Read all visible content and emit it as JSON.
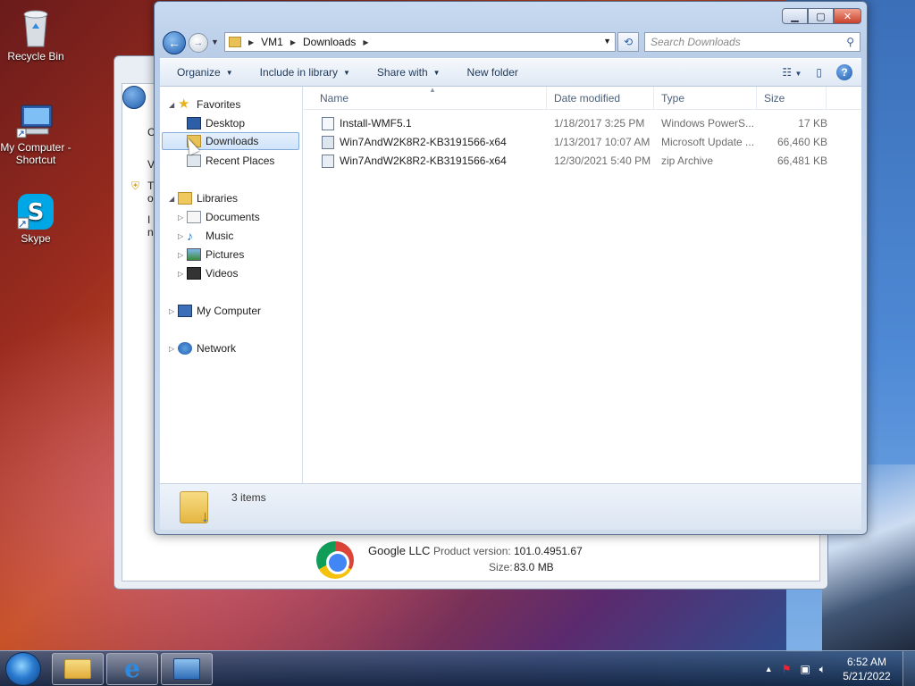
{
  "desktop": {
    "icons": [
      {
        "label": "Recycle Bin"
      },
      {
        "label": "My Computer - Shortcut"
      },
      {
        "label": "Skype"
      }
    ]
  },
  "background_window": {
    "letters": [
      "C",
      "V",
      "T",
      "o",
      "I",
      "n"
    ],
    "publisher": "Google LLC",
    "product_version_label": "Product version:",
    "product_version": "101.0.4951.67",
    "size_label": "Size:",
    "size": "83.0 MB"
  },
  "explorer": {
    "breadcrumb": [
      "VM1",
      "Downloads"
    ],
    "search_placeholder": "Search Downloads",
    "toolbar": {
      "organize": "Organize",
      "include_in_library": "Include in library",
      "share_with": "Share with",
      "new_folder": "New folder"
    },
    "nav": {
      "favorites": "Favorites",
      "desktop": "Desktop",
      "downloads": "Downloads",
      "recent_places": "Recent Places",
      "libraries": "Libraries",
      "documents": "Documents",
      "music": "Music",
      "pictures": "Pictures",
      "videos": "Videos",
      "my_computer": "My Computer",
      "network": "Network"
    },
    "columns": {
      "name": "Name",
      "date_modified": "Date modified",
      "type": "Type",
      "size": "Size"
    },
    "files": [
      {
        "name": "Install-WMF5.1",
        "date": "1/18/2017 3:25 PM",
        "type": "Windows PowerS...",
        "size": "17 KB"
      },
      {
        "name": "Win7AndW2K8R2-KB3191566-x64",
        "date": "1/13/2017 10:07 AM",
        "type": "Microsoft Update ...",
        "size": "66,460 KB"
      },
      {
        "name": "Win7AndW2K8R2-KB3191566-x64",
        "date": "12/30/2021 5:40 PM",
        "type": "zip Archive",
        "size": "66,481 KB"
      }
    ],
    "status": "3 items"
  },
  "taskbar": {
    "time": "6:52 AM",
    "date": "5/21/2022"
  },
  "colors": {
    "accent": "#1f5cae",
    "selection": "#cfe3fa"
  }
}
